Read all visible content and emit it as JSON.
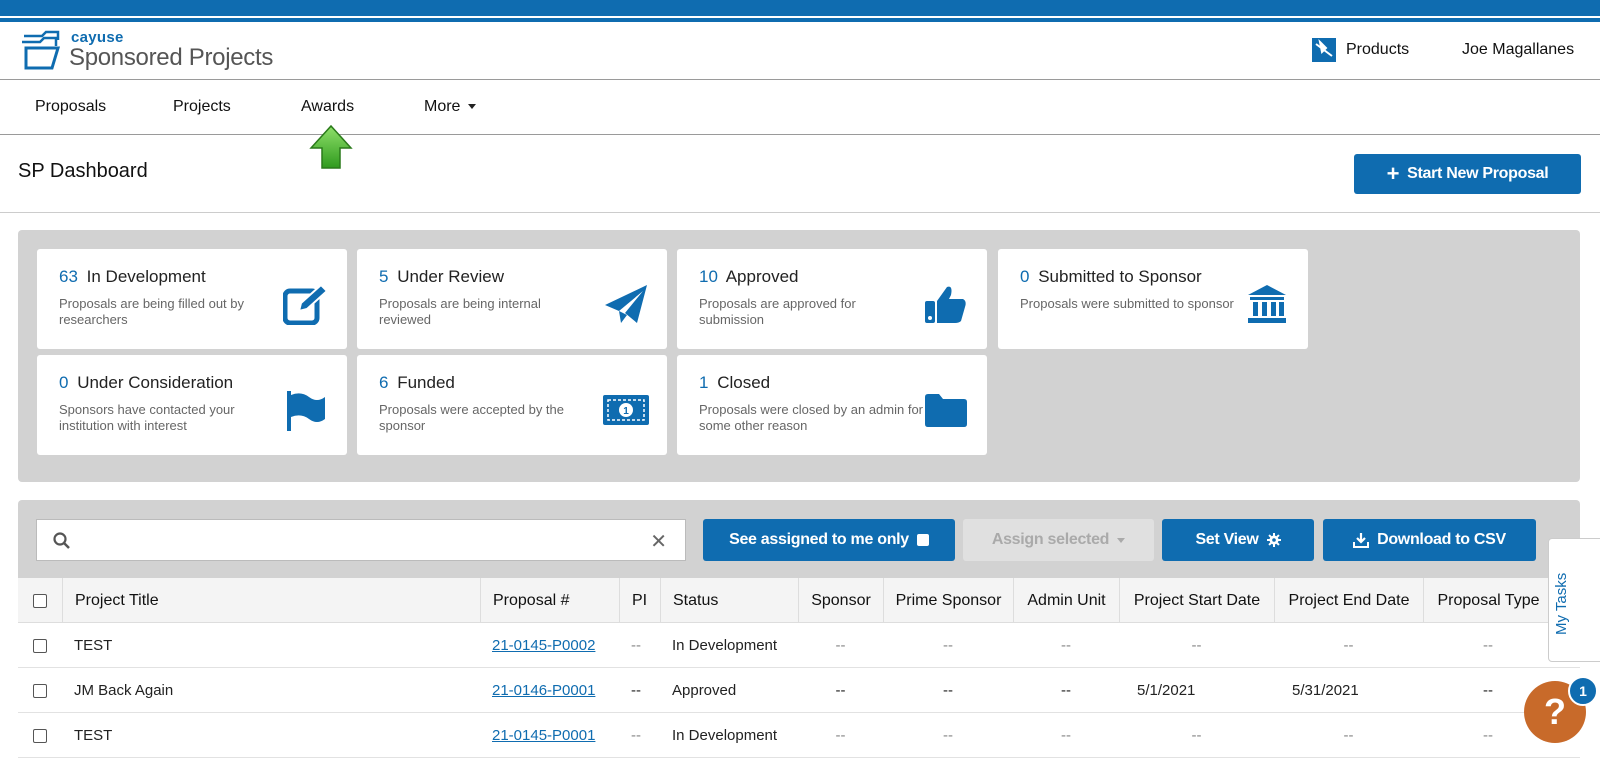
{
  "brand": {
    "small": "cayuse",
    "big": "Sponsored Projects"
  },
  "header": {
    "products_label": "Products",
    "user_name": "Joe Magallanes"
  },
  "nav": {
    "items": [
      {
        "label": "Proposals"
      },
      {
        "label": "Projects"
      },
      {
        "label": "Awards"
      },
      {
        "label": "More"
      }
    ]
  },
  "page": {
    "title": "SP Dashboard",
    "start_button": "Start New Proposal"
  },
  "cards": [
    {
      "count": "63",
      "label": "In Development",
      "desc": "Proposals are being filled out by researchers",
      "icon": "edit-icon"
    },
    {
      "count": "5",
      "label": "Under Review",
      "desc": "Proposals are being internal reviewed",
      "icon": "paper-plane-icon"
    },
    {
      "count": "10",
      "label": "Approved",
      "desc": "Proposals are approved for submission",
      "icon": "thumbs-up-icon"
    },
    {
      "count": "0",
      "label": "Submitted to Sponsor",
      "desc": "Proposals were submitted to sponsor",
      "icon": "bank-icon"
    },
    {
      "count": "0",
      "label": "Under Consideration",
      "desc": "Sponsors have contacted your institution with interest",
      "icon": "flag-icon"
    },
    {
      "count": "6",
      "label": "Funded",
      "desc": "Proposals were accepted by the sponsor",
      "icon": "money-icon"
    },
    {
      "count": "1",
      "label": "Closed",
      "desc": "Proposals were closed by an admin for some other reason",
      "icon": "folder-icon"
    }
  ],
  "toolbar": {
    "search_placeholder": "",
    "assigned_label": "See assigned to me only",
    "assign_selected_label": "Assign selected",
    "set_view_label": "Set View",
    "download_label": "Download to CSV"
  },
  "table": {
    "columns": [
      "Project Title",
      "Proposal #",
      "PI",
      "Status",
      "Sponsor",
      "Prime Sponsor",
      "Admin Unit",
      "Project Start Date",
      "Project End Date",
      "Proposal Type"
    ],
    "rows": [
      {
        "title": "TEST",
        "proposal": "21-0145-P0002",
        "pi": "--",
        "status": "In Development",
        "sponsor": "--",
        "prime": "--",
        "unit": "--",
        "start": "--",
        "end": "--",
        "type": "--"
      },
      {
        "title": "JM Back Again",
        "proposal": "21-0146-P0001",
        "pi": "--",
        "status": "Approved",
        "sponsor": "--",
        "prime": "--",
        "unit": "--",
        "start": "5/1/2021",
        "end": "5/31/2021",
        "type": "--"
      },
      {
        "title": "TEST",
        "proposal": "21-0145-P0001",
        "pi": "--",
        "status": "In Development",
        "sponsor": "--",
        "prime": "--",
        "unit": "--",
        "start": "--",
        "end": "--",
        "type": "--"
      }
    ]
  },
  "side": {
    "my_tasks": "My Tasks",
    "help_symbol": "?",
    "help_badge": "1"
  },
  "colors": {
    "primary": "#0f6cb0",
    "help": "#c86a2a",
    "arrow": "#3fae2a"
  }
}
